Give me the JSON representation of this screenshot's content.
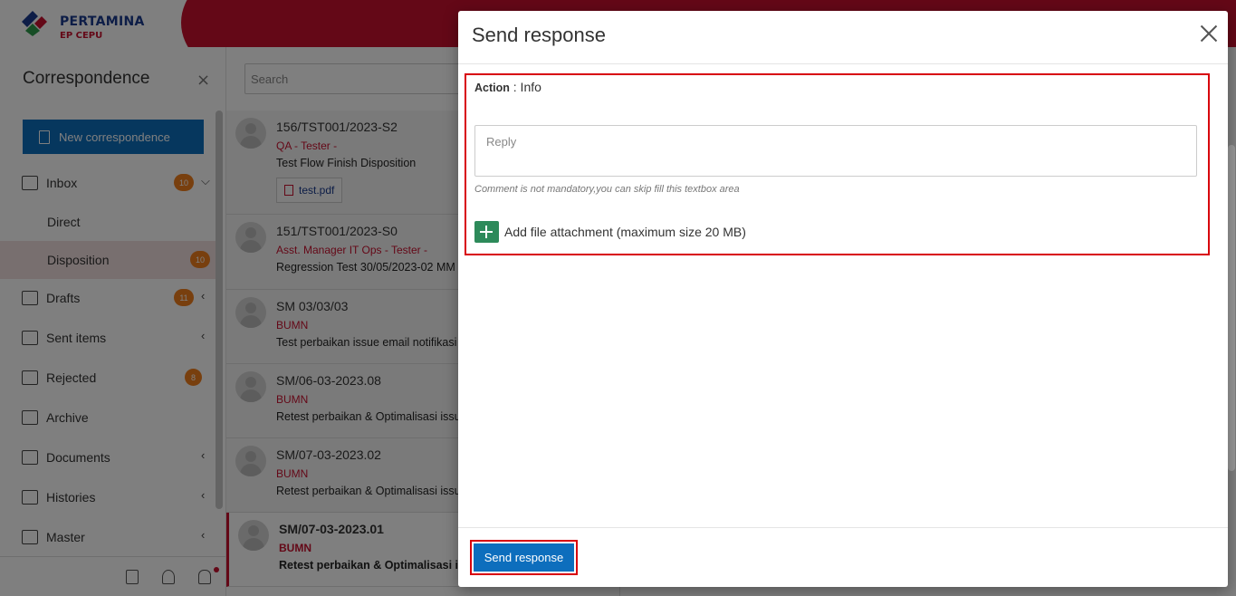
{
  "brand": {
    "name": "PERTAMINA",
    "sub": "EP CEPU"
  },
  "sidebar": {
    "title": "Correspondence",
    "close": "×",
    "new_button": "New correspondence",
    "items": [
      {
        "label": "Inbox",
        "badge": "10",
        "chev": "⌵"
      },
      {
        "label": "Direct"
      },
      {
        "label": "Disposition",
        "badge": "10"
      },
      {
        "label": "Drafts",
        "badge": "11",
        "chev": "‹"
      },
      {
        "label": "Sent items",
        "chev": "‹"
      },
      {
        "label": "Rejected",
        "badge": "8"
      },
      {
        "label": "Archive"
      },
      {
        "label": "Documents",
        "chev": "‹"
      },
      {
        "label": "Histories",
        "chev": "‹"
      },
      {
        "label": "Master",
        "chev": "‹"
      }
    ]
  },
  "list": {
    "search_placeholder": "Search",
    "mails": [
      {
        "no": "156/TST001/2023-S2",
        "from": "QA - Tester -",
        "subject": "Test Flow Finish Disposition",
        "attachment": "test.pdf"
      },
      {
        "no": "151/TST001/2023-S0",
        "from": "Asst. Manager IT Ops - Tester -",
        "subject": "Regression Test 30/05/2023-02 MM"
      },
      {
        "no": "SM 03/03/03",
        "from": "BUMN",
        "subject": "Test perbaikan issue email notifikasi"
      },
      {
        "no": "SM/06-03-2023.08",
        "from": "BUMN",
        "subject": "Retest perbaikan & Optimalisasi issu"
      },
      {
        "no": "SM/07-03-2023.02",
        "from": "BUMN",
        "subject": "Retest perbaikan & Optimalisasi issu"
      },
      {
        "no": "SM/07-03-2023.01",
        "from": "BUMN",
        "subject": "Retest perbaikan & Optimalisasi issu"
      }
    ]
  },
  "modal": {
    "title": "Send response",
    "action_label": "Action",
    "action_value": ": Info",
    "reply_placeholder": "Reply",
    "hint": "Comment is not mandatory,you can skip fill this textbox area",
    "add_attachment": "Add file attachment (maximum size 20 MB)",
    "send_button": "Send response"
  },
  "colors": {
    "brand_red": "#c8102e",
    "primary_blue": "#0d6ebd",
    "badge_orange": "#f07f1d",
    "add_green": "#2d8a5a",
    "highlight_red": "#d8000c"
  }
}
